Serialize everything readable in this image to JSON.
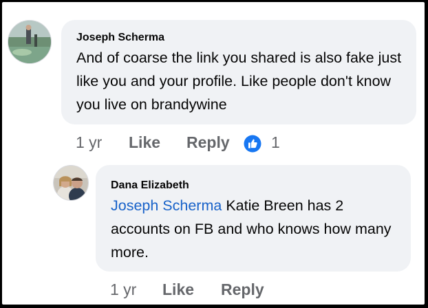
{
  "comments": [
    {
      "author": "Joseph Scherma",
      "text": "And of coarse the link you shared is also fake just like you and your profile. Like people don't know you live on brandywine",
      "time": "1 yr",
      "like_label": "Like",
      "reply_label": "Reply",
      "reaction_count": "1",
      "reaction_color": "#1877f2",
      "avatar_icon": "golf-course-photo"
    },
    {
      "author": "Dana Elizabeth",
      "mention": "Joseph Scherma",
      "text": " Katie Breen has 2 accounts on FB and who knows how many more.",
      "time": "1 yr",
      "like_label": "Like",
      "reply_label": "Reply",
      "avatar_icon": "couple-photo"
    }
  ]
}
